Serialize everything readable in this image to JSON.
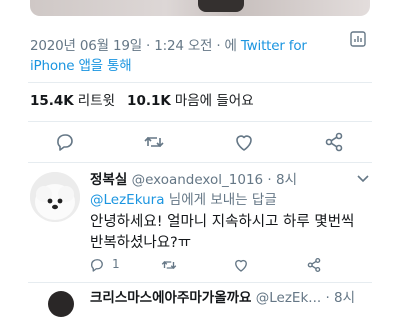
{
  "tweet": {
    "timestamp": "2020년 06월 19일 · 1:24 오전 · 에 ",
    "source_link": "Twitter for",
    "source_line2": "iPhone 앱을 통해",
    "stats": {
      "retweets_count": "15.4K",
      "retweets_label": "리트윗",
      "likes_count": "10.1K",
      "likes_label": "마음에 들어요"
    },
    "actions": [
      "reply-icon",
      "retweet-icon",
      "like-icon",
      "share-icon"
    ],
    "meta_icon": "analytics-icon"
  },
  "reply": {
    "display_name": "정복실",
    "handle": "@exoandexol_1016",
    "time": " · 8시",
    "reply_to_prefix": "",
    "reply_to_handle": "@LezEkura",
    "reply_to_suffix": " 님에게 보내는 답글",
    "text_line1": "안녕하세요! 얼마니 지속하시고 하루 몇번씩",
    "text_line2": "반복하셨나요?ㅠ",
    "reply_count": "1",
    "actions": [
      "reply-icon",
      "retweet-icon",
      "like-icon",
      "share-icon"
    ]
  },
  "next_reply": {
    "display_name": "크리스마스에아주마가올까요",
    "handle": " @LezEk...",
    "time": " · 8시"
  },
  "colors": {
    "link": "#1b95e0",
    "secondary_text": "#657786",
    "primary_text": "#14171a",
    "divider": "#e6ecf0"
  }
}
